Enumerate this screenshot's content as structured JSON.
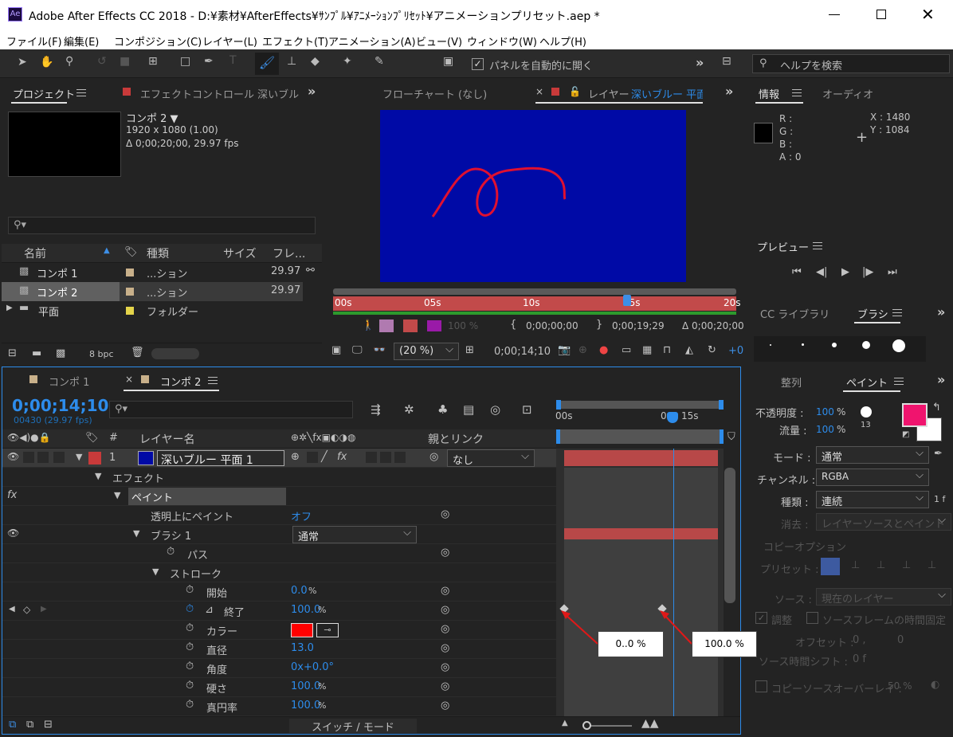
{
  "app": {
    "title": "Adobe After Effects CC 2018 - D:¥素材¥AfterEffects¥ｻﾝﾌﾟﾙ¥ｱﾆﾒｰｼｮﾝﾌﾟﾘｾｯﾄ¥アニメーションプリセット.aep *",
    "logo": "Ae"
  },
  "menu": [
    "ファイル(F)",
    "編集(E)",
    "コンポジション(C)",
    "レイヤー(L)",
    "エフェクト(T)",
    "アニメーション(A)",
    "ビュー(V)",
    "ウィンドウ(W)",
    "ヘルプ(H)"
  ],
  "toolbar": {
    "auto_open_label": "パネルを自動的に開く",
    "search_placeholder": "ヘルプを検索"
  },
  "project": {
    "tab_project": "プロジェクト",
    "tab_effect": "エフェクトコントロール 深いブル",
    "comp_name": "コンポ 2 ▼",
    "comp_size": "1920 x 1080 (1.00)",
    "comp_dur": "Δ 0;00;20;00, 29.97 fps",
    "columns": {
      "name": "名前",
      "type": "種類",
      "size": "サイズ",
      "frame": "フレ..."
    },
    "items": [
      {
        "name": "コンポ 1",
        "type": "...ション",
        "fps": "29.97"
      },
      {
        "name": "コンポ 2",
        "type": "...ション",
        "fps": "29.97"
      },
      {
        "name": "平面",
        "type": "フォルダー",
        "fps": ""
      }
    ],
    "bpc": "8 bpc"
  },
  "viewer": {
    "tab_flow": "フローチャート (なし)",
    "tab_layer_prefix": "レイヤー",
    "tab_layer_name": "深いブルー 平面",
    "ruler": [
      "00s",
      "05s",
      "10s",
      "15s",
      "20s"
    ],
    "time_in": "0;00;00;00",
    "time_out": "0;00;19;29",
    "time_dur": "Δ 0;00;20;00",
    "opacity": "100 %",
    "zoom": "(20 %)",
    "time": "0;00;14;10"
  },
  "info": {
    "tab_info": "情報",
    "tab_audio": "オーディオ",
    "r": "R :",
    "g": "G :",
    "b": "B :",
    "a": "A : 0",
    "x": "X : 1480",
    "y": "Y : 1084"
  },
  "preview": {
    "title": "プレビュー"
  },
  "brushes": {
    "tab_cc": "CC ライブラリ",
    "tab_brush": "ブラシ",
    "sizes": [
      "1",
      "3",
      "5",
      "9",
      "13"
    ]
  },
  "paint": {
    "tab_align": "整列",
    "tab_paint": "ペイント",
    "opacity_label": "不透明度 :",
    "opacity": "100",
    "flow_label": "流量 :",
    "flow": "100",
    "pct": "%",
    "brush_size": "13",
    "mode_label": "モード :",
    "mode": "通常",
    "channel_label": "チャンネル :",
    "channel": "RGBA",
    "type_label": "種類 :",
    "type": "連続",
    "type_suffix": "1 f",
    "erase_label": "消去 :",
    "erase": "レイヤーソースとペイント",
    "copy_options": "コピーオプション",
    "preset_label": "プリセット :",
    "source_label": "ソース :",
    "source": "現在のレイヤー",
    "align": "調整",
    "lock_source": "ソースフレームの時間固定",
    "offset_label": "オフセット :",
    "offset_x": "0 ,",
    "offset_y": "0",
    "shift_label": "ソース時間シフト :",
    "shift": "0 f",
    "overlay": "コピーソースオーバーレイ :",
    "overlay_val": "50 %",
    "fg_color": "#f0146e",
    "bg_color": "#ffffff"
  },
  "timeline": {
    "tab_comp1": "コンポ 1",
    "tab_comp2": "コンポ 2",
    "time": "0;00;14;10",
    "frames": "00430 (29.97 fps)",
    "col_layer": "レイヤー名",
    "col_parent": "親とリンク",
    "col_hash": "#",
    "ruler": [
      "00s",
      "0",
      "15s"
    ],
    "layer": {
      "num": "1",
      "name": "深いブルー 平面 1",
      "parent": "なし"
    },
    "props": {
      "effect": "エフェクト",
      "paint": "ペイント",
      "paint_on_transparent": "透明上にペイント",
      "paint_on_transparent_val": "オフ",
      "brush1": "ブラシ 1",
      "brush1_mode": "通常",
      "path": "パス",
      "stroke": "ストローク",
      "start": "開始",
      "start_val": "0.0",
      "end": "終了",
      "end_val": "100.0",
      "color": "カラー",
      "color_val": "#ff0000",
      "diameter": "直径",
      "diameter_val": "13.0",
      "angle": "角度",
      "angle_val": "0x+0.0°",
      "hardness": "硬さ",
      "hardness_val": "100.0",
      "roundness": "真円率",
      "roundness_val": "100.0",
      "pct": "%"
    },
    "switches": "スイッチ / モード"
  },
  "callouts": {
    "left": "0..0 %",
    "right": "100.0 %"
  }
}
